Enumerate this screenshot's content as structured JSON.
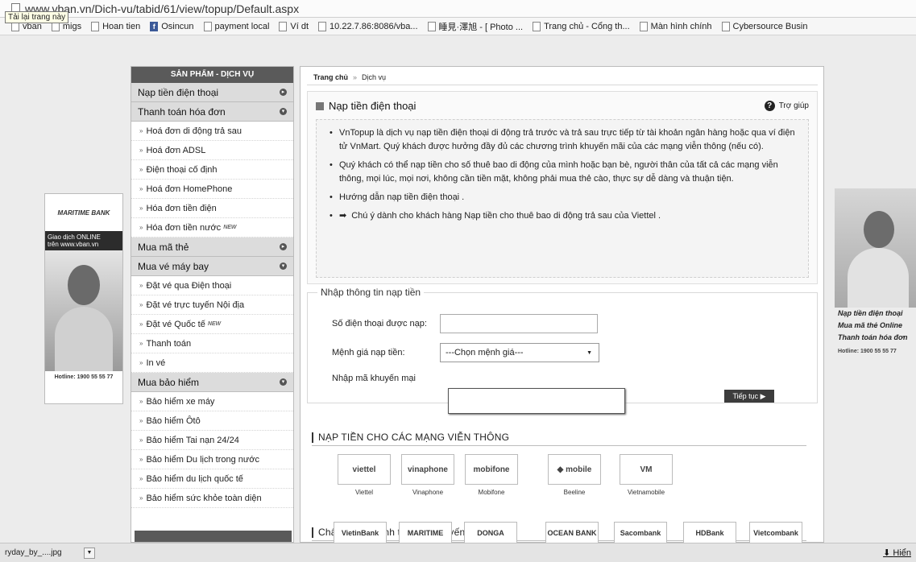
{
  "browser": {
    "url": "www.vban.vn/Dich-vu/tabid/61/view/topup/Default.aspx",
    "tooltip": "Tải lại trang này",
    "bookmarks": [
      "vban",
      "migs",
      "Hoan tien",
      "Osincun",
      "payment local",
      "Ví dt",
      "10.22.7.86:8086/vba...",
      "睡見·澤旭 - [ Photo ...",
      "Trang chủ - Cổng th...",
      "Màn hình chính",
      "Cybersource Busin"
    ]
  },
  "ad_left": {
    "bank": "MARITIME BANK",
    "slogan_1": "Giao dịch ONLINE",
    "slogan_2": "trên www.vban.vn",
    "hotline": "Hotline: 1900 55 55 77"
  },
  "sidebar": {
    "header": "SẢN PHẨM - DỊCH VỤ",
    "cat_topup": "Nạp tiền điện thoại",
    "cat_bills": "Thanh toán hóa đơn",
    "bills": [
      "Hoá đơn di động trả sau",
      "Hoá đơn ADSL",
      "Điện thoại cố định",
      "Hoá đơn HomePhone",
      "Hóa đơn tiền điện",
      "Hóa đơn tiền nước"
    ],
    "cat_card": "Mua mã thẻ",
    "cat_flight": "Mua vé máy bay",
    "flight": [
      "Đặt vé qua Điện thoại",
      "Đặt vé trực tuyến Nội địa",
      "Đặt vé Quốc tế",
      "Thanh toán",
      "In vé"
    ],
    "cat_insurance": "Mua bảo hiểm",
    "insurance": [
      "Bảo hiểm xe máy",
      "Bảo hiểm Ôtô",
      "Bảo hiểm Tai nạn 24/24",
      "Bảo hiểm Du lịch trong nước",
      "Bảo hiểm du lịch quốc tế",
      "Bảo hiểm sức khỏe toàn diện"
    ],
    "new_badge": "NEW"
  },
  "breadcrumb": {
    "home": "Trang chủ",
    "sep": "»",
    "current": "Dịch vụ"
  },
  "main": {
    "title": "Nạp tiền điện thoại",
    "help": "Trợ giúp",
    "info_1": "VnTopup là dịch vụ nạp tiền điện thoại di động trả trước và trả sau trực tiếp từ tài khoản ngân hàng hoặc qua ví điện tử VnMart. Quý khách được hưởng đầy đủ các chương trình khuyến mãi của các mạng viễn thông (nếu có).",
    "info_2": "Quý khách có thể nạp tiền cho số thuê bao di động của mình hoặc bạn bè, người thân của tất cả các mạng viễn thông, mọi lúc, mọi nơi, không cần tiền mặt, không phải mua thẻ cào, thực sự dễ dàng và thuận tiện.",
    "info_3": "Hướng dẫn nạp tiền điện thoại .",
    "info_4": "Chú ý dành cho khách hàng Nạp tiền cho thuê bao di động trả sau của Viettel ."
  },
  "form": {
    "legend": "Nhập thông tin nạp tiền",
    "phone_label": "Số điện thoại được nạp:",
    "phone_value": "",
    "amount_label": "Mệnh giá nạp tiền:",
    "amount_selected": "---Chọn mệnh giá---",
    "promo_label": "Nhập mã khuyến mại",
    "promo_value": "",
    "continue": "Tiếp tục ▶"
  },
  "carriers": {
    "heading": "NẠP TIỀN CHO CÁC MẠNG VIỄN THÔNG",
    "items": [
      {
        "logo": "viettel",
        "name": "Viettel"
      },
      {
        "logo": "vinaphone",
        "name": "Vinaphone"
      },
      {
        "logo": "mobifone",
        "name": "Mobifone"
      },
      {
        "logo": "◆ mobile",
        "name": "Beeline"
      },
      {
        "logo": "VM",
        "name": "Vietnamobile"
      }
    ]
  },
  "banks": {
    "heading": "Chấp nhận thanh toán trực tuyến",
    "items": [
      "VietinBank",
      "MARITIME",
      "DONGA",
      "OCEAN BANK",
      "Sacombank",
      "HDBank",
      "Vietcombank"
    ]
  },
  "ad_right": {
    "line_1": "Nạp tiền điện thoại",
    "line_2": "Mua mã thẻ Online",
    "line_3": "Thanh toán hóa đơn",
    "hotline": "Hotline: 1900 55 55 77"
  },
  "download_bar": {
    "file": "ryday_by_....jpg",
    "show": "Hiển"
  }
}
